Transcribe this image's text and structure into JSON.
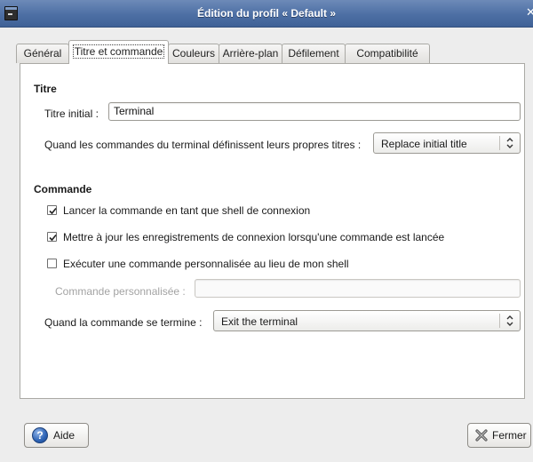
{
  "window": {
    "title": "Édition du profil « Default »"
  },
  "tabs": [
    {
      "label": "Général",
      "active": false
    },
    {
      "label": "Titre et commande",
      "active": true
    },
    {
      "label": "Couleurs",
      "active": false
    },
    {
      "label": "Arrière-plan",
      "active": false
    },
    {
      "label": "Défilement",
      "active": false
    },
    {
      "label": "Compatibilité",
      "active": false
    }
  ],
  "title_section": {
    "heading": "Titre",
    "initial_title_label": "Titre initial :",
    "initial_title_value": "Terminal",
    "dynamic_title_label": "Quand les commandes du terminal définissent leurs propres titres :",
    "dynamic_title_value": "Replace initial title"
  },
  "command_section": {
    "heading": "Commande",
    "login_shell": {
      "label": "Lancer la commande en tant que shell de connexion",
      "checked": true
    },
    "update_records": {
      "label": "Mettre à jour les enregistrements de connexion lorsqu'une commande est lancée",
      "checked": true
    },
    "custom_command": {
      "label": "Exécuter une commande personnalisée au lieu de mon shell",
      "checked": false
    },
    "custom_command_label": "Commande personnalisée :",
    "custom_command_value": "",
    "exit_action_label": "Quand la commande se termine :",
    "exit_action_value": "Exit the terminal"
  },
  "buttons": {
    "help": "Aide",
    "close": "Fermer"
  },
  "colors": {
    "titlebar": "#4d6fa4",
    "window_bg": "#ededed",
    "panel_bg": "#ffffff"
  },
  "icons": {
    "app": "terminal-icon",
    "help": "help-icon",
    "close": "close-icon",
    "combo": "up-down-arrows-icon"
  }
}
